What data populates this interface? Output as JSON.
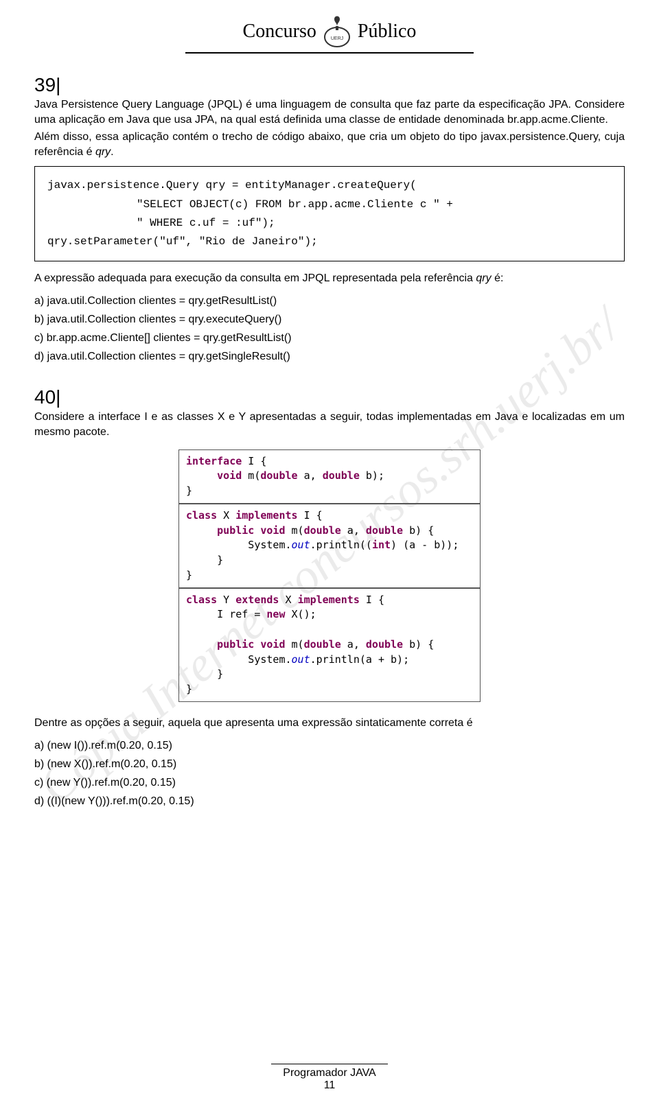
{
  "header": {
    "left": "Concurso",
    "right": "Público",
    "org": "UERJ"
  },
  "watermark": "Cópia Internet concursos.srh.uerj.br/",
  "q39": {
    "num": "39|",
    "p1": "Java Persistence Query Language (JPQL) é uma linguagem de consulta que faz parte da especificação JPA. Considere uma aplicação em Java que usa JPA, na qual está definida uma classe de entidade denominada br.app.acme.Cliente.",
    "p2_pre": "Além disso, essa aplicação contém o trecho de código abaixo, que cria um objeto do tipo javax.persistence.Query, cuja referência é ",
    "p2_em": "qry",
    "p2_post": ".",
    "code_l1": "javax.persistence.Query qry = entityManager.createQuery(",
    "code_l2": "\"SELECT OBJECT(c) FROM br.app.acme.Cliente c \" +",
    "code_l3": "\" WHERE c.uf = :uf\");",
    "code_l4": "qry.setParameter(\"uf\", \"Rio de Janeiro\");",
    "p3_pre": "A expressão adequada para execução da consulta em JPQL representada pela referência ",
    "p3_em": "qry",
    "p3_post": " é:",
    "a": "a) java.util.Collection clientes = qry.getResultList()",
    "b": "b) java.util.Collection clientes = qry.executeQuery()",
    "c": "c) br.app.acme.Cliente[] clientes = qry.getResultList()",
    "d": "d) java.util.Collection clientes = qry.getSingleResult()"
  },
  "q40": {
    "num": "40|",
    "p1": "Considere a interface I e as classes X e Y apresentadas a seguir, todas implementadas em Java e localizadas em um mesmo pacote.",
    "p2": "Dentre as opções a seguir, aquela que apresenta uma expressão sintaticamente correta é",
    "a": "a) (new I()).ref.m(0.20, 0.15)",
    "b": "b) (new X()).ref.m(0.20, 0.15)",
    "c": "c) (new Y()).ref.m(0.20, 0.15)",
    "d": "d) ((I)(new Y())).ref.m(0.20, 0.15)"
  },
  "footer": {
    "title": "Programador JAVA",
    "page": "11"
  }
}
